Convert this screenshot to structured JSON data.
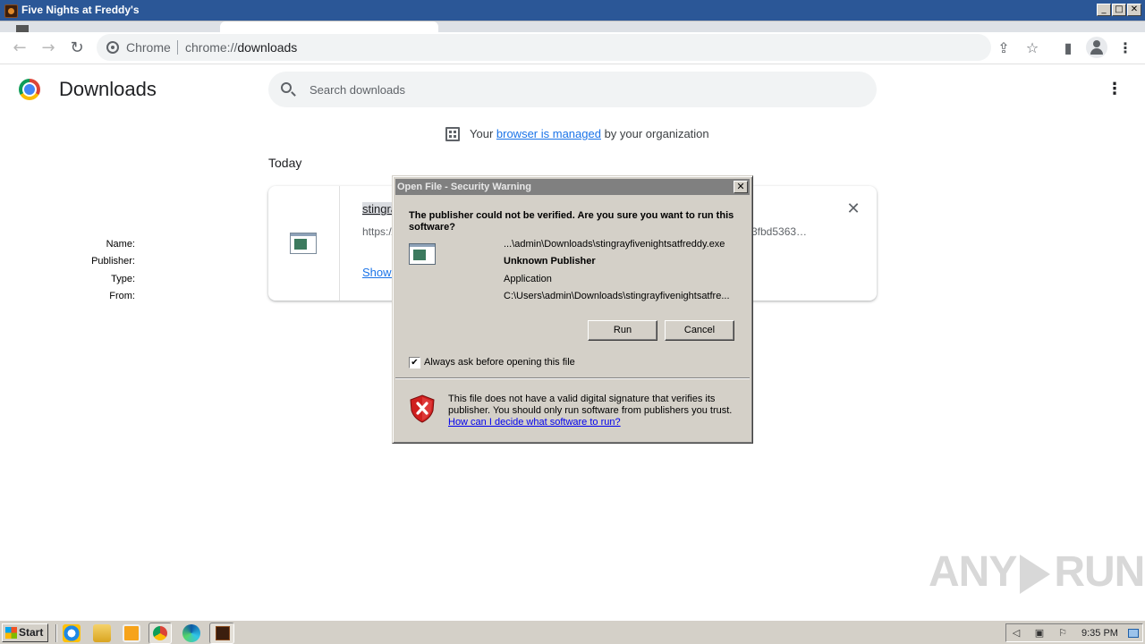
{
  "window": {
    "title": "Five Nights at Freddy's",
    "controls": {
      "minimize": "_",
      "maximize": "□",
      "close": "✕"
    }
  },
  "toolbar": {
    "back_icon": "←",
    "forward_icon": "→",
    "reload_icon": "↻",
    "omnibox_chip": "Chrome",
    "url_scheme": "chrome://",
    "url_host": "downloads",
    "share_icon": "⇪",
    "bookmark_icon": "☆",
    "sidepanel_icon": "▮",
    "menu_icon": "⋮"
  },
  "page": {
    "title": "Downloads",
    "search_placeholder": "Search downloads",
    "more_icon": "⋮",
    "managed_prefix": "Your ",
    "managed_link": "browser is managed",
    "managed_suffix": " by your organization",
    "section_label": "Today"
  },
  "download_item": {
    "filename": "stingrayfivenightsatfreddy.exe",
    "url_start": "https://",
    "url_tail": "3fbd5363…",
    "show_link": "Show in folder",
    "close_icon": "✕"
  },
  "dialog": {
    "title": "Open File - Security Warning",
    "close_glyph": "✕",
    "question": "The publisher could not be verified.  Are you sure you want to run this software?",
    "fields": [
      {
        "key": "Name:",
        "value": "...\\admin\\Downloads\\stingrayfivenightsatfreddy.exe",
        "bold": false
      },
      {
        "key": "Publisher:",
        "value": "Unknown Publisher",
        "bold": true
      },
      {
        "key": "Type:",
        "value": "Application",
        "bold": false
      },
      {
        "key": "From:",
        "value": "C:\\Users\\admin\\Downloads\\stingrayfivenightsatfre...",
        "bold": false
      }
    ],
    "run_label": "Run",
    "cancel_label": "Cancel",
    "checkbox_label": "Always ask before opening this file",
    "checkbox_checked": true,
    "checkbox_glyph": "✔",
    "warning_text": "This file does not have a valid digital signature that verifies its publisher.  You should only run software from publishers you trust.",
    "warning_link": "How can I decide what software to run?"
  },
  "watermark": {
    "left": "ANY",
    "right": "RUN"
  },
  "taskbar": {
    "start_label": "Start",
    "clock": "9:35 PM",
    "tray_icons": [
      "speaker-icon",
      "network-icon",
      "flag-icon"
    ]
  },
  "colors": {
    "link_blue": "#1a73e8",
    "dialog_face": "#d4d0c8",
    "titlebar_inactive": "#808080",
    "window_titlebar": "#2b5797"
  }
}
